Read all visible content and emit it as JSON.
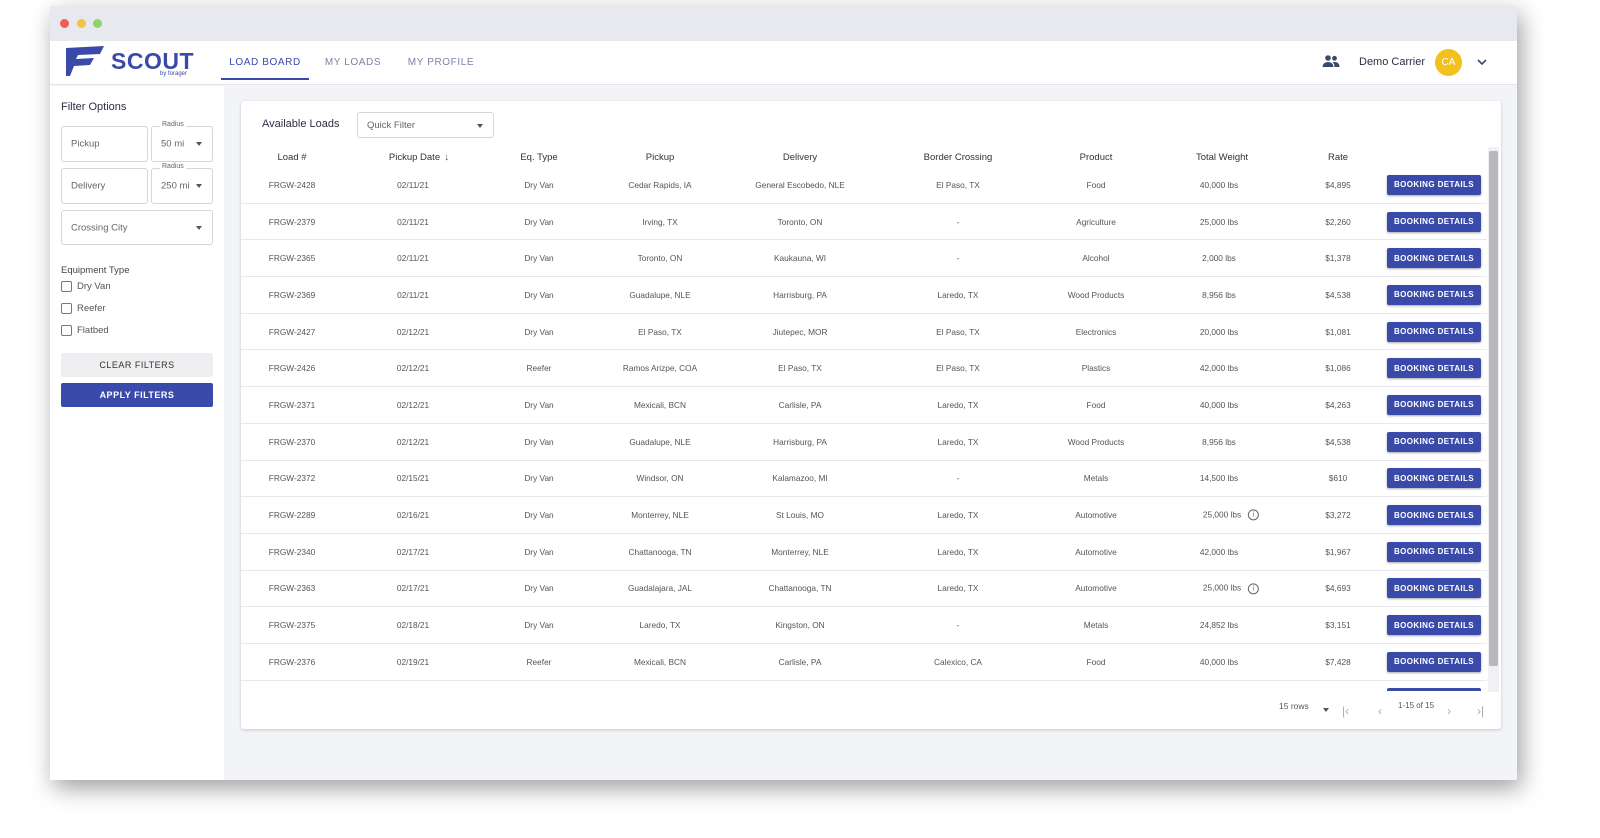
{
  "app": {
    "logo_text": "SCOUT",
    "logo_subtext": "by forager",
    "nav_tabs": [
      {
        "label": "LOAD BOARD"
      },
      {
        "label": "MY LOADS"
      },
      {
        "label": "MY PROFILE"
      }
    ],
    "user_name": "Demo Carrier",
    "avatar_initials": "CA",
    "icons": {
      "users": "people-icon",
      "menu": "chevron-down-icon"
    }
  },
  "filters": {
    "title": "Filter Options",
    "pickup_placeholder": "Pickup",
    "pickup_radius_label": "Radius",
    "pickup_radius_value": "50 mi",
    "delivery_placeholder": "Delivery",
    "delivery_radius_label": "Radius",
    "delivery_radius_value": "250 mi",
    "crossing_placeholder": "Crossing City",
    "equipment_title": "Equipment Type",
    "equipment": [
      {
        "label": "Dry Van",
        "checked": false
      },
      {
        "label": "Reefer",
        "checked": false
      },
      {
        "label": "Flatbed",
        "checked": false
      }
    ],
    "clear_label": "CLEAR FILTERS",
    "apply_label": "APPLY FILTERS"
  },
  "loads": {
    "title": "Available Loads",
    "quick_filter": "Quick Filter",
    "columns": [
      "Load #",
      "Pickup Date",
      "Eq. Type",
      "Pickup",
      "Delivery",
      "Border Crossing",
      "Product",
      "Total Weight",
      "Rate"
    ],
    "sort_indicator": "↓",
    "book_label": "BOOKING DETAILS",
    "rows": [
      {
        "load": "FRGW-2428",
        "date": "02/11/21",
        "eq": "Dry Van",
        "pickup": "Cedar Rapids, IA",
        "delivery": "General Escobedo, NLE",
        "border": "El Paso, TX",
        "product": "Food",
        "weight": "40,000 lbs",
        "info": false,
        "rate": "$4,895"
      },
      {
        "load": "FRGW-2379",
        "date": "02/11/21",
        "eq": "Dry Van",
        "pickup": "Irving, TX",
        "delivery": "Toronto, ON",
        "border": "-",
        "product": "Agriculture",
        "weight": "25,000 lbs",
        "info": false,
        "rate": "$2,260"
      },
      {
        "load": "FRGW-2365",
        "date": "02/11/21",
        "eq": "Dry Van",
        "pickup": "Toronto, ON",
        "delivery": "Kaukauna, WI",
        "border": "-",
        "product": "Alcohol",
        "weight": "2,000 lbs",
        "info": false,
        "rate": "$1,378"
      },
      {
        "load": "FRGW-2369",
        "date": "02/11/21",
        "eq": "Dry Van",
        "pickup": "Guadalupe, NLE",
        "delivery": "Harrisburg, PA",
        "border": "Laredo, TX",
        "product": "Wood Products",
        "weight": "8,956 lbs",
        "info": false,
        "rate": "$4,538"
      },
      {
        "load": "FRGW-2427",
        "date": "02/12/21",
        "eq": "Dry Van",
        "pickup": "El Paso, TX",
        "delivery": "Jiutepec, MOR",
        "border": "El Paso, TX",
        "product": "Electronics",
        "weight": "20,000 lbs",
        "info": false,
        "rate": "$1,081"
      },
      {
        "load": "FRGW-2426",
        "date": "02/12/21",
        "eq": "Reefer",
        "pickup": "Ramos Arizpe, COA",
        "delivery": "El Paso, TX",
        "border": "El Paso, TX",
        "product": "Plastics",
        "weight": "42,000 lbs",
        "info": false,
        "rate": "$1,086"
      },
      {
        "load": "FRGW-2371",
        "date": "02/12/21",
        "eq": "Dry Van",
        "pickup": "Mexicali, BCN",
        "delivery": "Carlisle, PA",
        "border": "Laredo, TX",
        "product": "Food",
        "weight": "40,000 lbs",
        "info": false,
        "rate": "$4,263"
      },
      {
        "load": "FRGW-2370",
        "date": "02/12/21",
        "eq": "Dry Van",
        "pickup": "Guadalupe, NLE",
        "delivery": "Harrisburg, PA",
        "border": "Laredo, TX",
        "product": "Wood Products",
        "weight": "8,956 lbs",
        "info": false,
        "rate": "$4,538"
      },
      {
        "load": "FRGW-2372",
        "date": "02/15/21",
        "eq": "Dry Van",
        "pickup": "Windsor, ON",
        "delivery": "Kalamazoo, MI",
        "border": "-",
        "product": "Metals",
        "weight": "14,500 lbs",
        "info": false,
        "rate": "$610"
      },
      {
        "load": "FRGW-2289",
        "date": "02/16/21",
        "eq": "Dry Van",
        "pickup": "Monterrey, NLE",
        "delivery": "St Louis, MO",
        "border": "Laredo, TX",
        "product": "Automotive",
        "weight": "25,000 lbs",
        "info": true,
        "rate": "$3,272"
      },
      {
        "load": "FRGW-2340",
        "date": "02/17/21",
        "eq": "Dry Van",
        "pickup": "Chattanooga, TN",
        "delivery": "Monterrey, NLE",
        "border": "Laredo, TX",
        "product": "Automotive",
        "weight": "42,000 lbs",
        "info": false,
        "rate": "$1,967"
      },
      {
        "load": "FRGW-2363",
        "date": "02/17/21",
        "eq": "Dry Van",
        "pickup": "Guadalajara, JAL",
        "delivery": "Chattanooga, TN",
        "border": "Laredo, TX",
        "product": "Automotive",
        "weight": "25,000 lbs",
        "info": true,
        "rate": "$4,693"
      },
      {
        "load": "FRGW-2375",
        "date": "02/18/21",
        "eq": "Dry Van",
        "pickup": "Laredo, TX",
        "delivery": "Kingston, ON",
        "border": "-",
        "product": "Metals",
        "weight": "24,852 lbs",
        "info": false,
        "rate": "$3,151"
      },
      {
        "load": "FRGW-2376",
        "date": "02/19/21",
        "eq": "Reefer",
        "pickup": "Mexicali, BCN",
        "delivery": "Carlisle, PA",
        "border": "Calexico, CA",
        "product": "Food",
        "weight": "40,000 lbs",
        "info": false,
        "rate": "$7,428"
      }
    ],
    "pager": {
      "rows_label": "15 rows",
      "range_label": "1-15 of 15"
    }
  }
}
